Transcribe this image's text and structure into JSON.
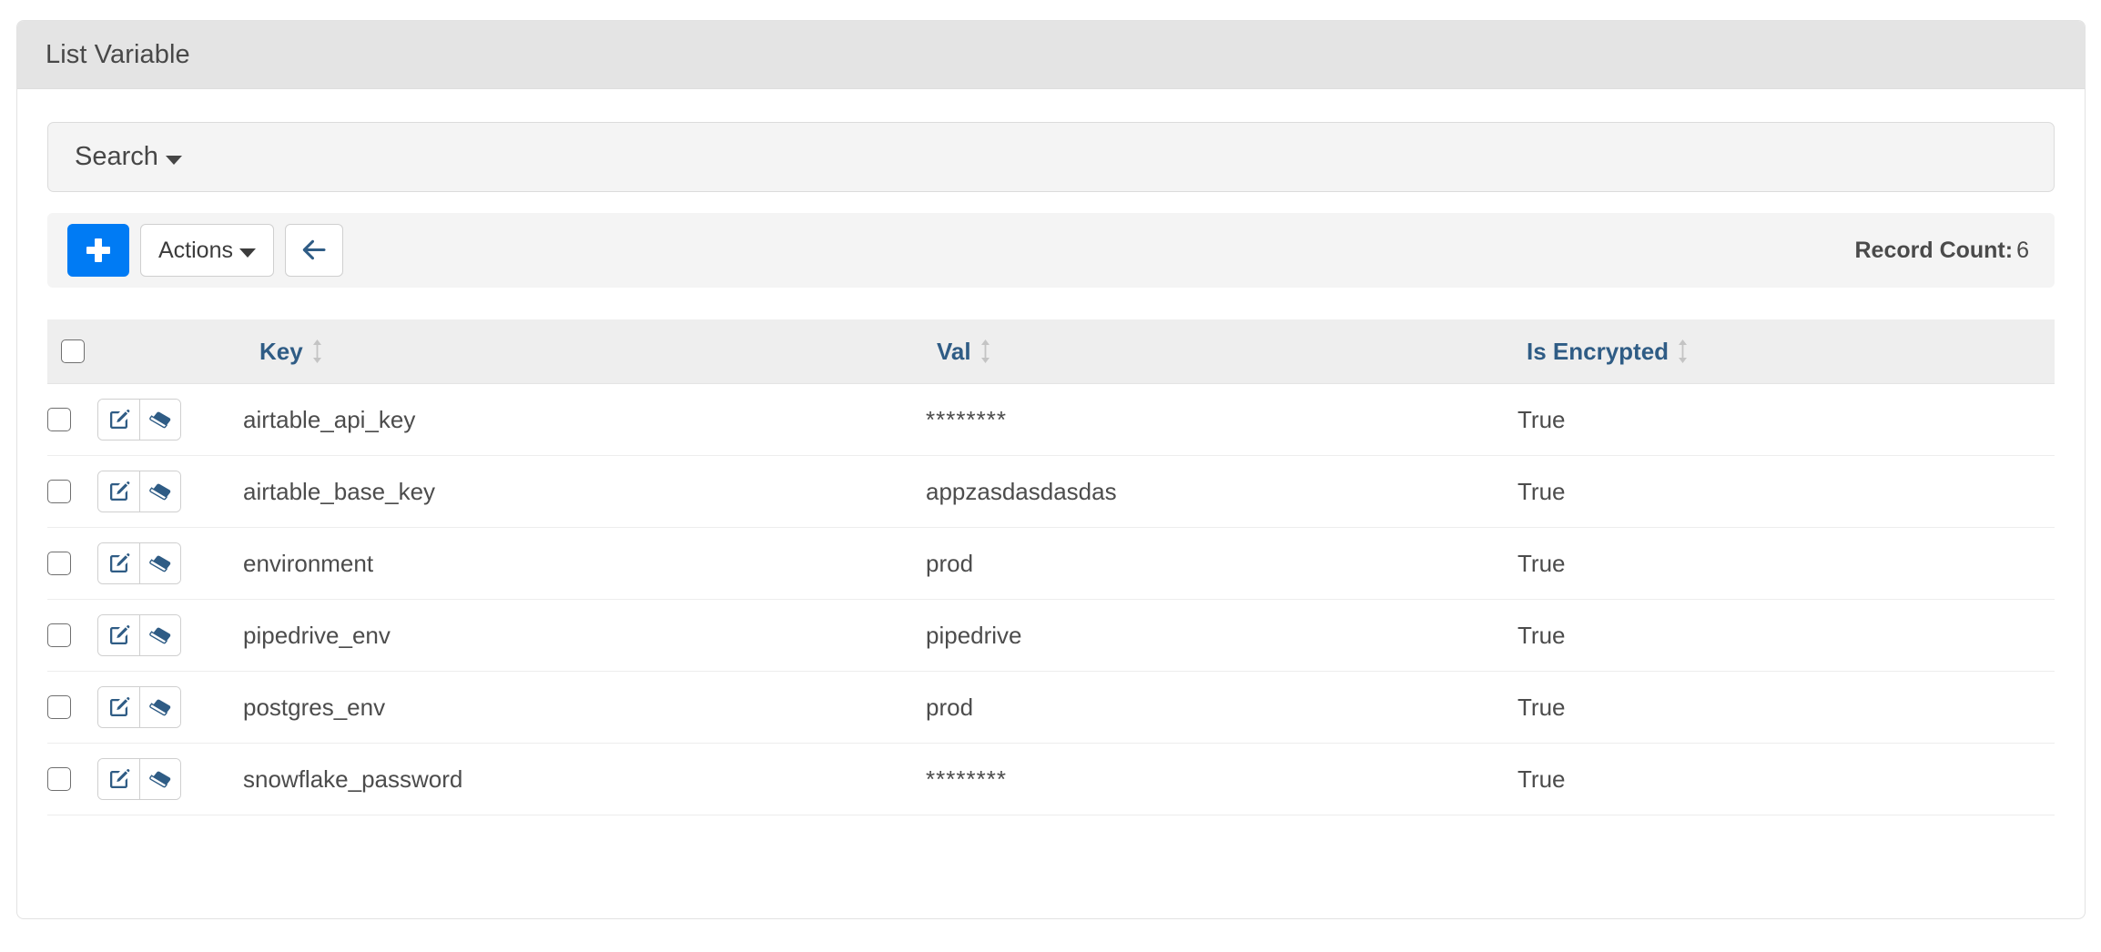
{
  "card": {
    "title": "List Variable"
  },
  "search": {
    "label": "Search",
    "caret_icon": "chevron-down-icon"
  },
  "toolbar": {
    "add_label": "+",
    "add_icon": "plus-icon",
    "actions_label": "Actions",
    "actions_caret_icon": "chevron-down-icon",
    "back_icon": "arrow-left-icon",
    "record_count_label": "Record Count:",
    "record_count_value": "6"
  },
  "table": {
    "select_all_name": "select-all-checkbox",
    "sort_icon": "sort-updown-icon",
    "row_edit_icon": "edit-pencil-icon",
    "row_erase_icon": "eraser-icon",
    "columns": [
      {
        "key": "key",
        "label": "Key"
      },
      {
        "key": "val",
        "label": "Val"
      },
      {
        "key": "encrypted",
        "label": "Is Encrypted"
      }
    ],
    "rows": [
      {
        "key": "airtable_api_key",
        "val": "********",
        "encrypted": "True"
      },
      {
        "key": "airtable_base_key",
        "val": "appzasdasdasdas",
        "encrypted": "True"
      },
      {
        "key": "environment",
        "val": "prod",
        "encrypted": "True"
      },
      {
        "key": "pipedrive_env",
        "val": "pipedrive",
        "encrypted": "True"
      },
      {
        "key": "postgres_env",
        "val": "prod",
        "encrypted": "True"
      },
      {
        "key": "snowflake_password",
        "val": "********",
        "encrypted": "True"
      }
    ]
  },
  "colors": {
    "accent_blue": "#007bf4",
    "header_link_blue": "#2f5c85",
    "icon_navy": "#2f5c85",
    "card_header_bg": "#e4e4e4",
    "panel_bg": "#f4f4f4",
    "table_header_bg": "#eeeeee"
  }
}
